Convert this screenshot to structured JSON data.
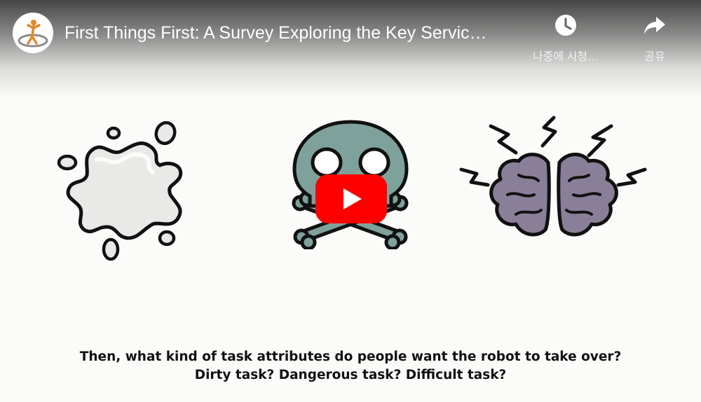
{
  "player": {
    "title": "First Things First: A Survey Exploring the Key Servic…",
    "watch_later_label": "나중에 시청…",
    "share_label": "공유",
    "play_button_color": "#ff0000"
  },
  "subtitles": {
    "line1": "Then, what kind of task attributes do people want the robot to take over?",
    "line2": "Dirty task? Dangerous task? Difficult task?"
  },
  "icons": {
    "channel_logo": "channel-logo-icon",
    "watch_later": "clock-icon",
    "share": "share-arrow-icon",
    "play": "play-icon"
  }
}
